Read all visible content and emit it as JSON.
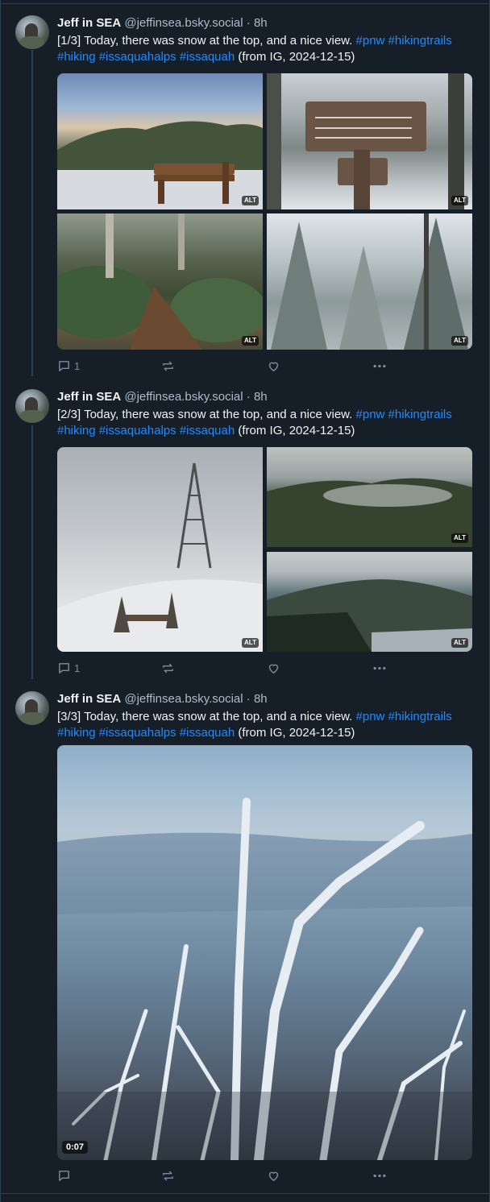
{
  "posts": [
    {
      "author_name": "Jeff in SEA",
      "handle": "@jeffinsea.bsky.social",
      "time": "· 8h",
      "text_prefix": "[1/3] Today, there was snow at the top, and a nice view.",
      "tags": [
        "#pnw",
        "#hikingtrails",
        "#hiking",
        "#issaquahalps",
        "#issaquah"
      ],
      "text_suffix": "(from IG, 2024-12-15)",
      "media_badges": [
        "ALT",
        "ALT",
        "ALT",
        "ALT"
      ],
      "reply_count": "1"
    },
    {
      "author_name": "Jeff in SEA",
      "handle": "@jeffinsea.bsky.social",
      "time": "· 8h",
      "text_prefix": "[2/3] Today, there was snow at the top, and a nice view.",
      "tags": [
        "#pnw",
        "#hikingtrails",
        "#hiking",
        "#issaquahalps",
        "#issaquah"
      ],
      "text_suffix": "(from IG, 2024-12-15)",
      "media_badges": [
        "ALT",
        "ALT",
        "ALT"
      ],
      "reply_count": "1"
    },
    {
      "author_name": "Jeff in SEA",
      "handle": "@jeffinsea.bsky.social",
      "time": "· 8h",
      "text_prefix": "[3/3] Today, there was snow at the top, and a nice view.",
      "tags": [
        "#pnw",
        "#hikingtrails",
        "#hiking",
        "#issaquahalps",
        "#issaquah"
      ],
      "text_suffix": "(from IG, 2024-12-15)",
      "video_duration": "0:07",
      "reply_count": ""
    }
  ],
  "icons": {
    "reply": "reply-icon",
    "repost": "repost-icon",
    "like": "heart-icon",
    "more": "more-icon"
  },
  "colors": {
    "background": "#161e27",
    "link": "#208bfe",
    "secondary_text": "#aebbc9",
    "icon": "#7b8d9f"
  }
}
